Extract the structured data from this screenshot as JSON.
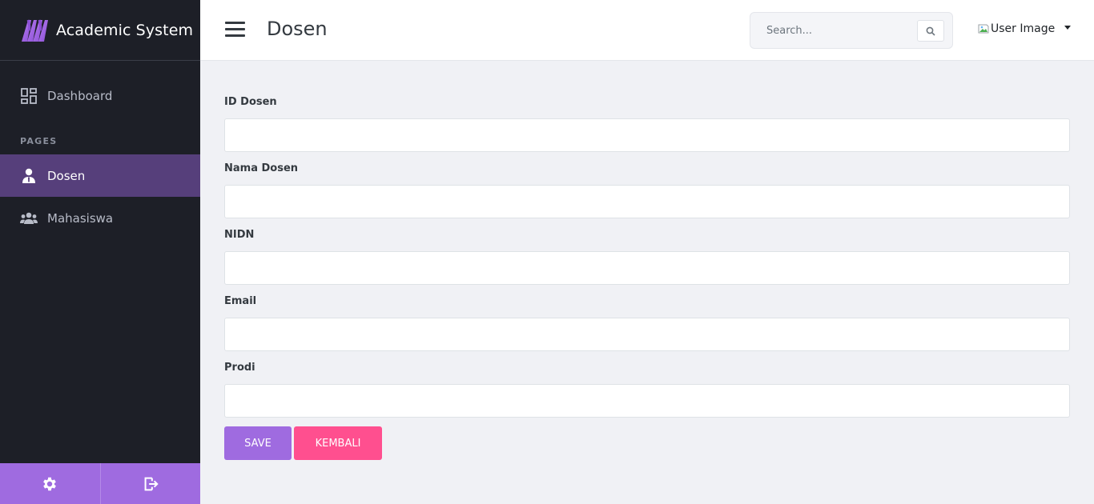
{
  "sidebar": {
    "brand": "Academic System",
    "items": [
      {
        "label": "Dashboard"
      },
      {
        "label": "Dosen"
      },
      {
        "label": "Mahasiswa"
      }
    ],
    "heading": "PAGES"
  },
  "header": {
    "title": "Dosen",
    "search_placeholder": "Search...",
    "user_image_alt": "User Image"
  },
  "form": {
    "fields": [
      {
        "label": "ID Dosen",
        "value": ""
      },
      {
        "label": "Nama Dosen",
        "value": ""
      },
      {
        "label": "NIDN",
        "value": ""
      },
      {
        "label": "Email",
        "value": ""
      },
      {
        "label": "Prodi",
        "value": ""
      }
    ],
    "save_label": "SAVE",
    "back_label": "KEMBALI"
  },
  "colors": {
    "sidebar_bg": "#1d1f27",
    "active_item": "#563f7b",
    "accent_purple": "#9f6be0",
    "accent_pink": "#ff4f8f",
    "page_bg": "#f0f1f5"
  },
  "icons": {
    "brand": "wave-logo-icon",
    "dashboard": "dashboard-grid-icon",
    "dosen": "person-tie-icon",
    "mahasiswa": "people-group-icon",
    "menu": "hamburger-icon",
    "search": "search-icon",
    "settings": "gear-icon",
    "logout": "logout-icon"
  }
}
